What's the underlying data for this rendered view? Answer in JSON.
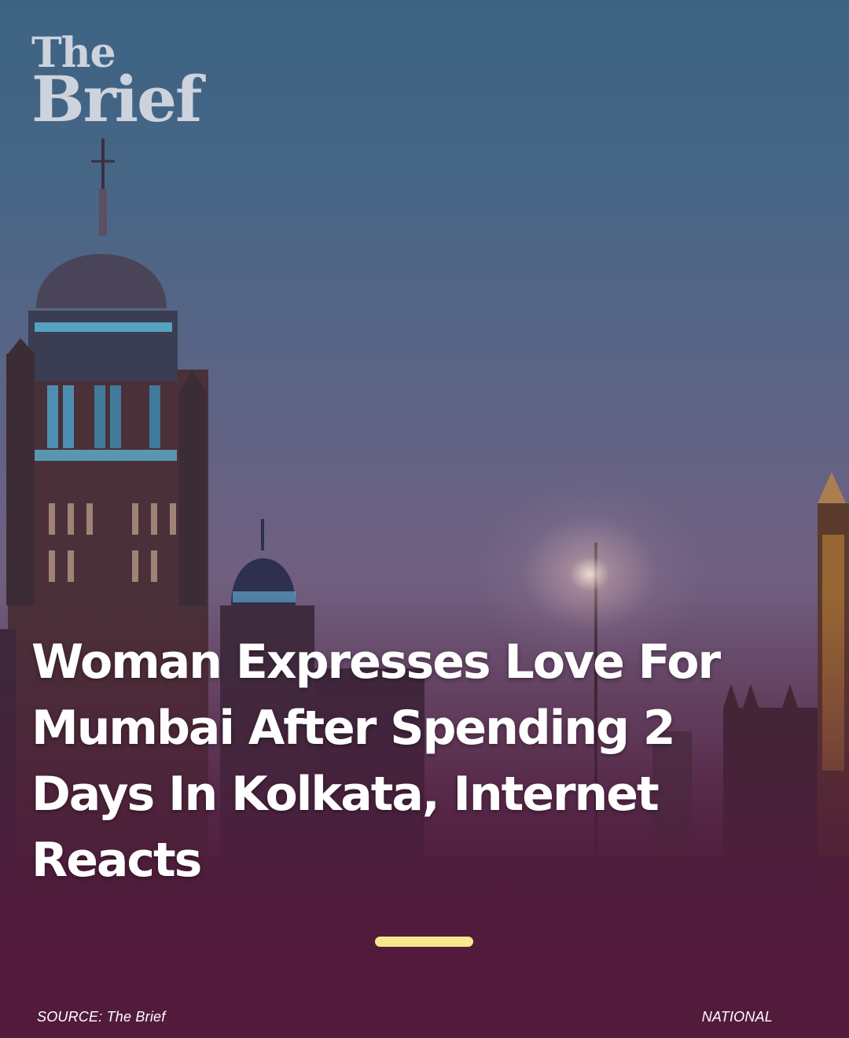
{
  "brand": {
    "line1": "The",
    "line2": "Brief"
  },
  "story": {
    "headline": "Woman Expresses Love For Mumbai After Spending 2 Days In Kolkata, Internet Reacts"
  },
  "progress": {
    "active_index": 0
  },
  "footer": {
    "source": "SOURCE: The Brief",
    "category": "NATIONAL"
  },
  "colors": {
    "accent_indicator": "#f6e98d",
    "footer_bg": "#521b3c",
    "text": "#ffffff"
  }
}
